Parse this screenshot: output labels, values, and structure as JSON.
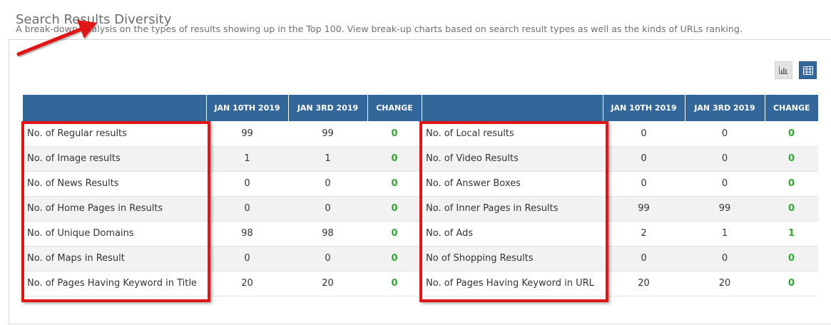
{
  "header": {
    "title": "Search Results Diversity",
    "subtitle": "A break-down analysis on the types of results showing up in the Top 100. View break-up charts based on search result types as well as the kinds of URLs ranking."
  },
  "toolbar": {
    "chart_view_icon": "bar-chart-icon",
    "table_view_icon": "table-icon",
    "active_view": "table"
  },
  "table": {
    "columns": {
      "left_label": "",
      "left_date1": "JAN 10TH 2019",
      "left_date2": "JAN 3RD 2019",
      "left_change": "CHANGE",
      "right_label": "",
      "right_date1": "JAN 10TH 2019",
      "right_date2": "JAN 3RD 2019",
      "right_change": "CHANGE"
    },
    "rows": [
      {
        "left": {
          "label": "No. of Regular results",
          "d1": "99",
          "d2": "99",
          "change": "0"
        },
        "right": {
          "label": "No. of Local results",
          "d1": "0",
          "d2": "0",
          "change": "0"
        }
      },
      {
        "left": {
          "label": "No. of Image results",
          "d1": "1",
          "d2": "1",
          "change": "0"
        },
        "right": {
          "label": "No. of Video Results",
          "d1": "0",
          "d2": "0",
          "change": "0"
        }
      },
      {
        "left": {
          "label": "No. of News Results",
          "d1": "0",
          "d2": "0",
          "change": "0"
        },
        "right": {
          "label": "No. of Answer Boxes",
          "d1": "0",
          "d2": "0",
          "change": "0"
        }
      },
      {
        "left": {
          "label": "No. of Home Pages in Results",
          "d1": "0",
          "d2": "0",
          "change": "0"
        },
        "right": {
          "label": "No. of Inner Pages in Results",
          "d1": "99",
          "d2": "99",
          "change": "0"
        }
      },
      {
        "left": {
          "label": "No. of Unique Domains",
          "d1": "98",
          "d2": "98",
          "change": "0"
        },
        "right": {
          "label": "No. of Ads",
          "d1": "2",
          "d2": "1",
          "change": "1"
        }
      },
      {
        "left": {
          "label": "No. of Maps in Result",
          "d1": "0",
          "d2": "0",
          "change": "0"
        },
        "right": {
          "label": "No of Shopping Results",
          "d1": "0",
          "d2": "0",
          "change": "0"
        }
      },
      {
        "left": {
          "label": "No. of Pages Having Keyword in Title",
          "d1": "20",
          "d2": "20",
          "change": "0"
        },
        "right": {
          "label": "No. of Pages Having Keyword in URL",
          "d1": "20",
          "d2": "20",
          "change": "0"
        }
      }
    ]
  },
  "colors": {
    "header_blue": "#336699",
    "change_green": "#2eaa2e",
    "annotation_red": "#e01515"
  }
}
